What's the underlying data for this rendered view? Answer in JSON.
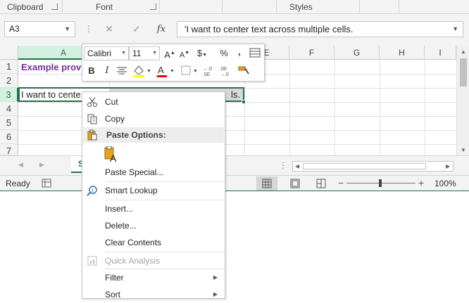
{
  "ribbon": {
    "groups": [
      "Clipboard",
      "Font",
      "Styles"
    ]
  },
  "formula_bar": {
    "name_box": "A3",
    "cancel_symbol": "✕",
    "enter_symbol": "✓",
    "fx_symbol": "fx",
    "formula": "'I want to center text across multiple cells."
  },
  "grid": {
    "columns": [
      "A",
      "E",
      "F",
      "G",
      "H",
      "I"
    ],
    "rows": [
      "1",
      "2",
      "3",
      "4",
      "5",
      "6",
      "7"
    ],
    "cells": {
      "A1": "Example provi",
      "A3": "I want to cente",
      "A3_tail": "ls."
    },
    "selected_cell": "A3"
  },
  "mini_toolbar": {
    "font_name": "Calibri",
    "font_size": "11",
    "currency": "$",
    "percent": "%",
    "comma": ",",
    "bold": "B",
    "italic": "I",
    "highlight_color": "#ffff00",
    "font_color": "#ff0000"
  },
  "context_menu": {
    "cut": "Cut",
    "copy": "Copy",
    "paste_options": "Paste Options:",
    "paste_special": "Paste Special...",
    "smart_lookup": "Smart Lookup",
    "insert": "Insert...",
    "delete": "Delete...",
    "clear_contents": "Clear Contents",
    "quick_analysis": "Quick Analysis",
    "filter": "Filter",
    "sort": "Sort"
  },
  "sheet_bar": {
    "sheet_tab": "S"
  },
  "status_bar": {
    "ready": "Ready",
    "zoom": "100%",
    "zoom_fraction": 0.5
  },
  "colors": {
    "accent": "#217346",
    "title_text": "#7030a0"
  }
}
